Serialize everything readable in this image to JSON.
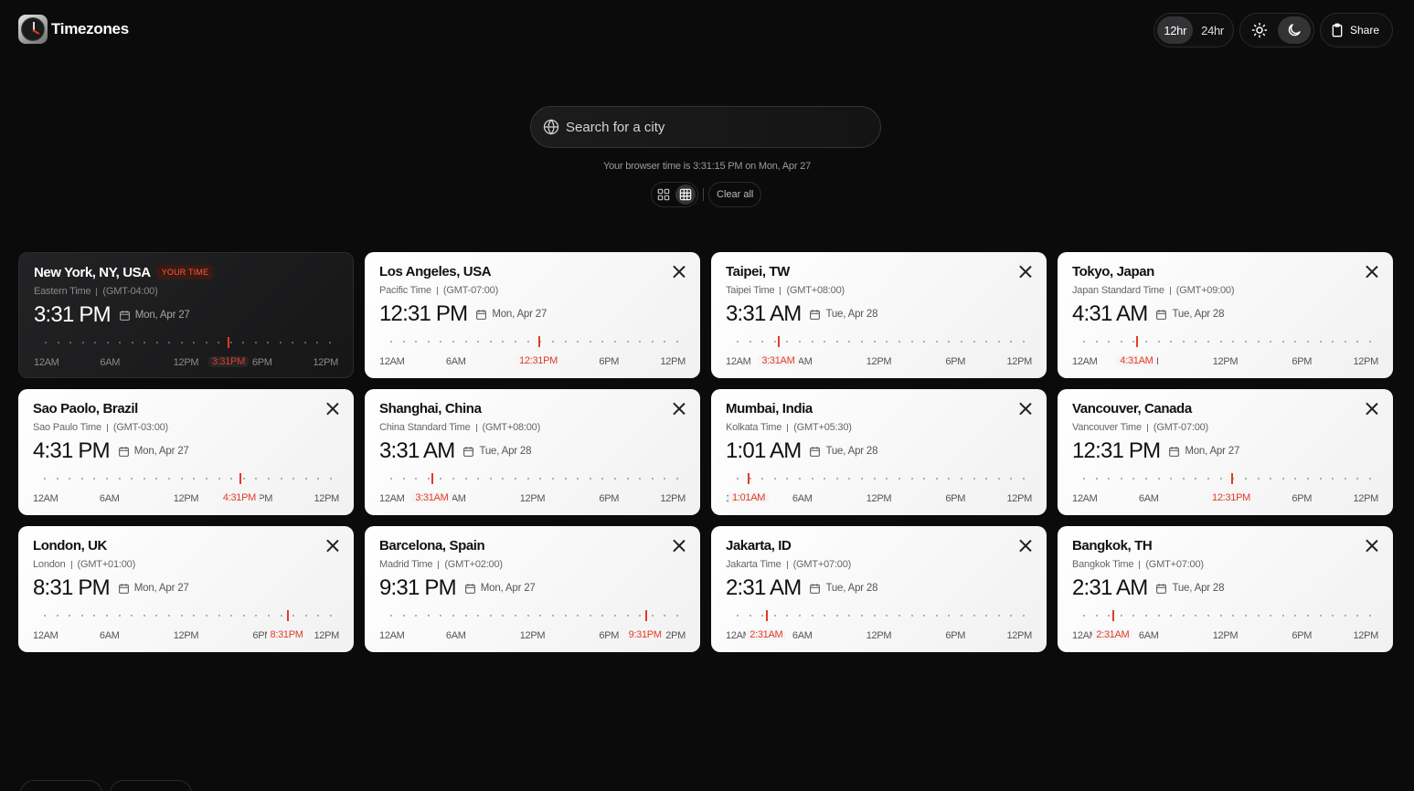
{
  "app": {
    "title": "Timezones"
  },
  "header": {
    "format_12": "12hr",
    "format_24": "24hr",
    "active_format": "12hr",
    "theme_light_icon": "sun-icon",
    "theme_dark_icon": "moon-icon",
    "active_theme": "dark",
    "share_label": "Share"
  },
  "search": {
    "placeholder": "Search for a city",
    "value": ""
  },
  "browser_time_text": "Your browser time is 3:31:15 PM on Mon, Apr 27",
  "view": {
    "active": "grid",
    "clear_label": "Clear all"
  },
  "colors": {
    "accent": "#e23b25",
    "background": "#0b0b0c",
    "card": "#ffffff"
  },
  "cards": [
    {
      "city": "New York, NY, USA",
      "badge": "YOUR TIME",
      "zone": "Eastern Time",
      "offset": "(GMT-04:00)",
      "time": "3:31 PM",
      "date": "Mon, Apr 27",
      "now_label": "3:31PM",
      "hour_fraction": 0.646,
      "removable": false
    },
    {
      "city": "Los Angeles, USA",
      "badge": "",
      "zone": "Pacific Time",
      "offset": "(GMT-07:00)",
      "time": "12:31 PM",
      "date": "Mon, Apr 27",
      "now_label": "12:31PM",
      "hour_fraction": 0.521,
      "removable": true
    },
    {
      "city": "Taipei, TW",
      "badge": "",
      "zone": "Taipei Time",
      "offset": "(GMT+08:00)",
      "time": "3:31 AM",
      "date": "Tue, Apr 28",
      "now_label": "3:31AM",
      "hour_fraction": 0.146,
      "removable": true
    },
    {
      "city": "Tokyo, Japan",
      "badge": "",
      "zone": "Japan Standard Time",
      "offset": "(GMT+09:00)",
      "time": "4:31 AM",
      "date": "Tue, Apr 28",
      "now_label": "4:31AM",
      "hour_fraction": 0.188,
      "removable": true
    },
    {
      "city": "Sao Paolo, Brazil",
      "badge": "",
      "zone": "Sao Paulo Time",
      "offset": "(GMT-03:00)",
      "time": "4:31 PM",
      "date": "Mon, Apr 27",
      "now_label": "4:31PM",
      "hour_fraction": 0.688,
      "removable": true
    },
    {
      "city": "Shanghai, China",
      "badge": "",
      "zone": "China Standard Time",
      "offset": "(GMT+08:00)",
      "time": "3:31 AM",
      "date": "Tue, Apr 28",
      "now_label": "3:31AM",
      "hour_fraction": 0.146,
      "removable": true
    },
    {
      "city": "Mumbai, India",
      "badge": "",
      "zone": "Kolkata Time",
      "offset": "(GMT+05:30)",
      "time": "1:01 AM",
      "date": "Tue, Apr 28",
      "now_label": "1:01AM",
      "hour_fraction": 0.042,
      "removable": true
    },
    {
      "city": "Vancouver, Canada",
      "badge": "",
      "zone": "Vancouver Time",
      "offset": "(GMT-07:00)",
      "time": "12:31 PM",
      "date": "Mon, Apr 27",
      "now_label": "12:31PM",
      "hour_fraction": 0.521,
      "removable": true
    },
    {
      "city": "London, UK",
      "badge": "",
      "zone": "London",
      "offset": "(GMT+01:00)",
      "time": "8:31 PM",
      "date": "Mon, Apr 27",
      "now_label": "8:31PM",
      "hour_fraction": 0.854,
      "removable": true
    },
    {
      "city": "Barcelona, Spain",
      "badge": "",
      "zone": "Madrid Time",
      "offset": "(GMT+02:00)",
      "time": "9:31 PM",
      "date": "Mon, Apr 27",
      "now_label": "9:31PM",
      "hour_fraction": 0.896,
      "removable": true
    },
    {
      "city": "Jakarta, ID",
      "badge": "",
      "zone": "Jakarta Time",
      "offset": "(GMT+07:00)",
      "time": "2:31 AM",
      "date": "Tue, Apr 28",
      "now_label": "2:31AM",
      "hour_fraction": 0.104,
      "removable": true
    },
    {
      "city": "Bangkok, TH",
      "badge": "",
      "zone": "Bangkok Time",
      "offset": "(GMT+07:00)",
      "time": "2:31 AM",
      "date": "Tue, Apr 28",
      "now_label": "2:31AM",
      "hour_fraction": 0.104,
      "removable": true
    }
  ],
  "scale_labels": [
    "12AM",
    "6AM",
    "12PM",
    "6PM",
    "12PM"
  ]
}
